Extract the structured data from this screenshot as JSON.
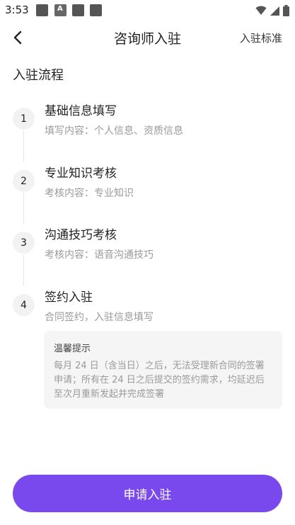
{
  "status_bar": {
    "time": "3:53",
    "notification_icons": [
      "gallery-icon",
      "a-icon",
      "gallery-icon",
      "gallery-icon"
    ],
    "right_icons": [
      "wifi-icon",
      "signal-icon",
      "battery-icon"
    ]
  },
  "header": {
    "title": "咨询师入驻",
    "right_link": "入驻标准",
    "back_icon": "chevron-left-icon"
  },
  "section": {
    "title": "入驻流程"
  },
  "steps": [
    {
      "num": "1",
      "title": "基础信息填写",
      "desc": "填写内容：个人信息、资质信息"
    },
    {
      "num": "2",
      "title": "专业知识考核",
      "desc": "考核内容：专业知识"
    },
    {
      "num": "3",
      "title": "沟通技巧考核",
      "desc": "考核内容：语音沟通技巧"
    },
    {
      "num": "4",
      "title": "签约入驻",
      "desc": "合同签约，入驻信息填写"
    }
  ],
  "tip": {
    "title": "温馨提示",
    "line1": "每月 24 日（含当日）之后，无法受理新合同的签署",
    "line2": "申请；所有在 24 日之后提交的签约需求，均延迟后",
    "line3": "至次月重新发起并完成签署"
  },
  "apply_button": {
    "label": "申请入驻"
  },
  "colors": {
    "accent": "#7a49ee",
    "step_circle": "#f2f2f2",
    "muted_text": "#9a9a9a",
    "tip_bg": "#f5f5f5"
  }
}
